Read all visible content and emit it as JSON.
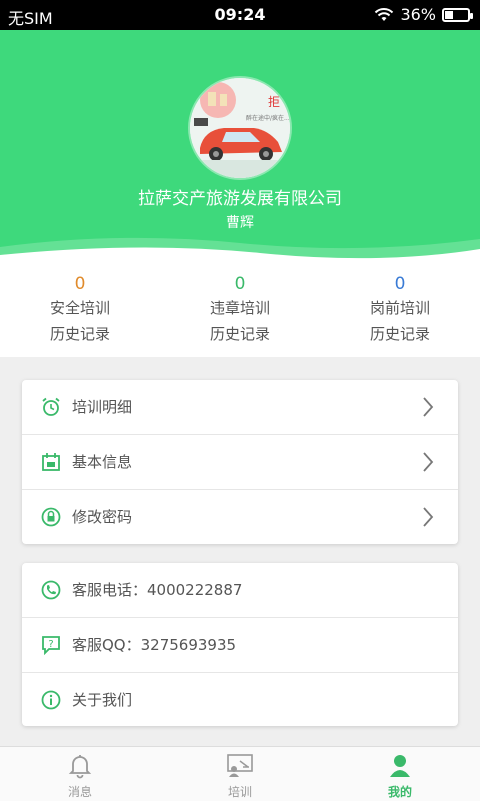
{
  "status_bar": {
    "carrier": "无SIM",
    "time": "09:24",
    "battery": "36%",
    "battery_level": 0.36
  },
  "profile": {
    "company": "拉萨交产旅游发展有限公司",
    "name": "曹辉",
    "avatar_banner_text": "拒",
    "avatar_banner_sub": "醉在途中/疯在..."
  },
  "stats": [
    {
      "count": "0",
      "line1": "安全培训",
      "line2": "历史记录",
      "color": "#e08b2c"
    },
    {
      "count": "0",
      "line1": "违章培训",
      "line2": "历史记录",
      "color": "#3ab96a"
    },
    {
      "count": "0",
      "line1": "岗前培训",
      "line2": "历史记录",
      "color": "#3a7bd5"
    }
  ],
  "menu1": [
    {
      "label": "培训明细",
      "icon": "alarm-clock-icon"
    },
    {
      "label": "基本信息",
      "icon": "calendar-icon"
    },
    {
      "label": "修改密码",
      "icon": "lock-icon"
    }
  ],
  "menu2": [
    {
      "label": "客服电话：4000222887",
      "icon": "phone-icon"
    },
    {
      "label": "客服QQ：3275693935",
      "icon": "chat-question-icon"
    },
    {
      "label": "关于我们",
      "icon": "info-icon"
    }
  ],
  "nav": [
    {
      "label": "消息",
      "icon": "bell-icon",
      "active": false
    },
    {
      "label": "培训",
      "icon": "training-icon",
      "active": false
    },
    {
      "label": "我的",
      "icon": "user-icon",
      "active": true
    }
  ],
  "colors": {
    "accent": "#3ed97c",
    "icon_green": "#3ab96a"
  }
}
